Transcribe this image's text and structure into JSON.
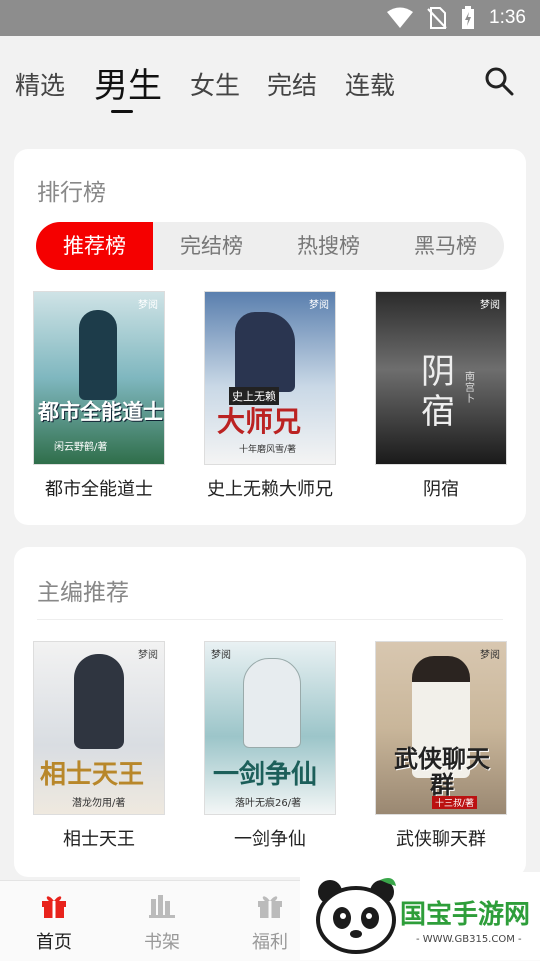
{
  "status_bar": {
    "time": "1:36"
  },
  "top_tabs": [
    "精选",
    "男生",
    "女生",
    "完结",
    "连载"
  ],
  "ranking": {
    "title": "排行榜",
    "pills": [
      "推荐榜",
      "完结榜",
      "热搜榜",
      "黑马榜"
    ],
    "books": [
      {
        "title": "都市全能道士",
        "cover_text": "都市全能道士",
        "cover_author": "闲云野鹤/著"
      },
      {
        "title": "史上无赖大师兄",
        "cover_text": "大师兄",
        "cover_sub": "史上无赖",
        "cover_author": "十年磨风雪/著"
      },
      {
        "title": "阴宿",
        "cover_text": "阴宿",
        "cover_author": "南宫卜"
      }
    ]
  },
  "editor": {
    "title": "主编推荐",
    "books": [
      {
        "title": "相士天王",
        "cover_text": "相士天王",
        "cover_author": "潜龙勿用/著"
      },
      {
        "title": "一剑争仙",
        "cover_text": "一剑争仙",
        "cover_author": "落叶无痕26/著"
      },
      {
        "title": "武侠聊天群",
        "cover_text": "武侠聊天群",
        "cover_author": "十三叔/著"
      }
    ]
  },
  "publisher_logo": "梦阅",
  "bottom_nav": [
    "首页",
    "书架",
    "福利"
  ],
  "watermark": {
    "text": "国宝手游网",
    "url": "- WWW.GB315.COM -"
  }
}
